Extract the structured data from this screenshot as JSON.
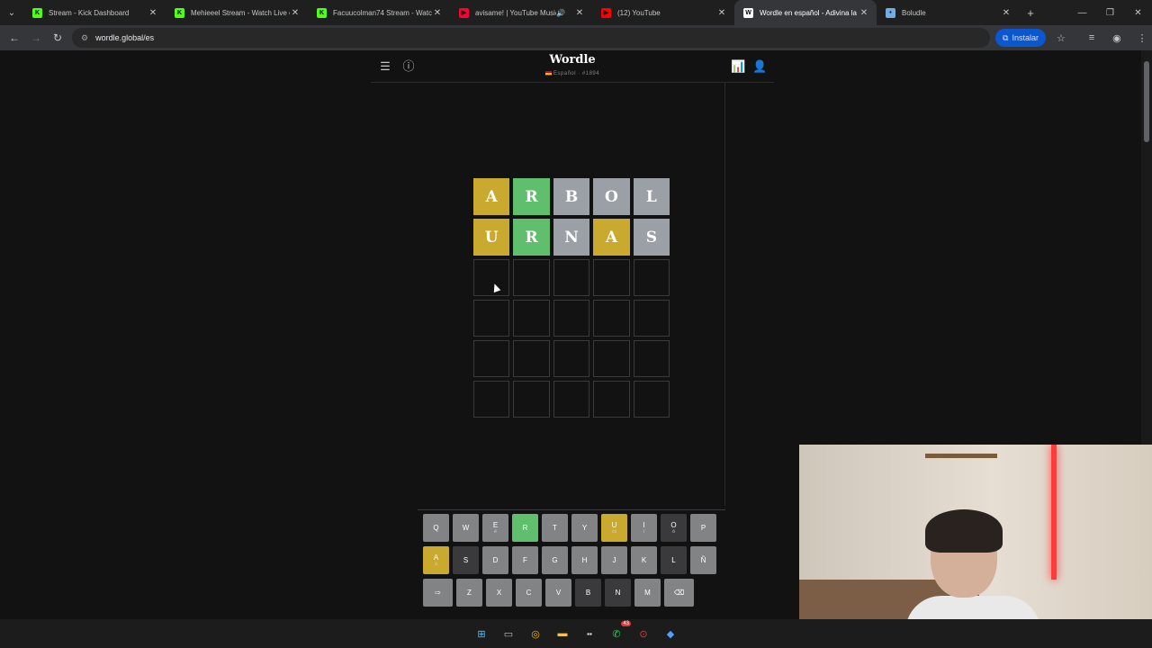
{
  "browser": {
    "tabs": [
      {
        "title": "Stream - Kick Dashboard",
        "icon": "kick-icon",
        "fav_color": "#53fc18",
        "fav_text": "K"
      },
      {
        "title": "Mehieeel Stream - Watch Live o",
        "icon": "kick-icon",
        "fav_color": "#53fc18",
        "fav_text": "K"
      },
      {
        "title": "Facuucolman74 Stream - Watch",
        "icon": "kick-icon",
        "fav_color": "#53fc18",
        "fav_text": "K"
      },
      {
        "title": "avisame! | YouTube Music",
        "icon": "youtube-music-icon",
        "fav_color": "#ff0033",
        "fav_text": "▶"
      },
      {
        "title": "(12) YouTube",
        "icon": "youtube-icon",
        "fav_color": "#ff0000",
        "fav_text": "▶"
      },
      {
        "title": "Wordle en español - Adivina la",
        "icon": "wordle-icon",
        "fav_color": "#ffffff",
        "fav_text": "W"
      },
      {
        "title": "Boludle",
        "icon": "globe-icon",
        "fav_color": "#74acdf",
        "fav_text": "•"
      }
    ],
    "active_tab": 5,
    "url": "wordle.global/es",
    "install_label": "Instalar"
  },
  "game": {
    "logo": "Wordle",
    "subtitle": "Español · #1894",
    "board": [
      [
        {
          "l": "A",
          "s": "present"
        },
        {
          "l": "R",
          "s": "correct"
        },
        {
          "l": "B",
          "s": "absent"
        },
        {
          "l": "O",
          "s": "absent"
        },
        {
          "l": "L",
          "s": "absent"
        }
      ],
      [
        {
          "l": "U",
          "s": "present"
        },
        {
          "l": "R",
          "s": "correct"
        },
        {
          "l": "N",
          "s": "absent"
        },
        {
          "l": "A",
          "s": "present"
        },
        {
          "l": "S",
          "s": "absent"
        }
      ],
      [
        {
          "l": "",
          "s": "empty"
        },
        {
          "l": "",
          "s": "empty"
        },
        {
          "l": "",
          "s": "empty"
        },
        {
          "l": "",
          "s": "empty"
        },
        {
          "l": "",
          "s": "empty"
        }
      ],
      [
        {
          "l": "",
          "s": "empty"
        },
        {
          "l": "",
          "s": "empty"
        },
        {
          "l": "",
          "s": "empty"
        },
        {
          "l": "",
          "s": "empty"
        },
        {
          "l": "",
          "s": "empty"
        }
      ],
      [
        {
          "l": "",
          "s": "empty"
        },
        {
          "l": "",
          "s": "empty"
        },
        {
          "l": "",
          "s": "empty"
        },
        {
          "l": "",
          "s": "empty"
        },
        {
          "l": "",
          "s": "empty"
        }
      ],
      [
        {
          "l": "",
          "s": "empty"
        },
        {
          "l": "",
          "s": "empty"
        },
        {
          "l": "",
          "s": "empty"
        },
        {
          "l": "",
          "s": "empty"
        },
        {
          "l": "",
          "s": "empty"
        }
      ]
    ],
    "keyboard": [
      [
        {
          "k": "Q",
          "s": ""
        },
        {
          "k": "W",
          "s": ""
        },
        {
          "k": "E",
          "s": "",
          "a": "é"
        },
        {
          "k": "R",
          "s": "correct"
        },
        {
          "k": "T",
          "s": ""
        },
        {
          "k": "Y",
          "s": ""
        },
        {
          "k": "U",
          "s": "present",
          "a": "úü"
        },
        {
          "k": "I",
          "s": "",
          "a": "í"
        },
        {
          "k": "O",
          "s": "absent",
          "a": "ó"
        },
        {
          "k": "P",
          "s": ""
        }
      ],
      [
        {
          "k": "A",
          "s": "present",
          "a": "á"
        },
        {
          "k": "S",
          "s": "absent"
        },
        {
          "k": "D",
          "s": ""
        },
        {
          "k": "F",
          "s": ""
        },
        {
          "k": "G",
          "s": ""
        },
        {
          "k": "H",
          "s": ""
        },
        {
          "k": "J",
          "s": ""
        },
        {
          "k": "K",
          "s": ""
        },
        {
          "k": "L",
          "s": "absent"
        },
        {
          "k": "Ñ",
          "s": ""
        }
      ],
      [
        {
          "k": "⇨",
          "s": "",
          "w": true
        },
        {
          "k": "Z",
          "s": ""
        },
        {
          "k": "X",
          "s": ""
        },
        {
          "k": "C",
          "s": ""
        },
        {
          "k": "V",
          "s": ""
        },
        {
          "k": "B",
          "s": "absent"
        },
        {
          "k": "N",
          "s": "absent"
        },
        {
          "k": "M",
          "s": ""
        },
        {
          "k": "⌫",
          "s": "",
          "w": true
        }
      ]
    ]
  },
  "taskbar": {
    "icons": [
      "windows-start-icon",
      "file-explorer-icon",
      "chrome-icon",
      "folder-icon",
      "app-icon",
      "whatsapp-icon",
      "recording-icon",
      "app2-icon"
    ],
    "whatsapp_badge": "43"
  }
}
